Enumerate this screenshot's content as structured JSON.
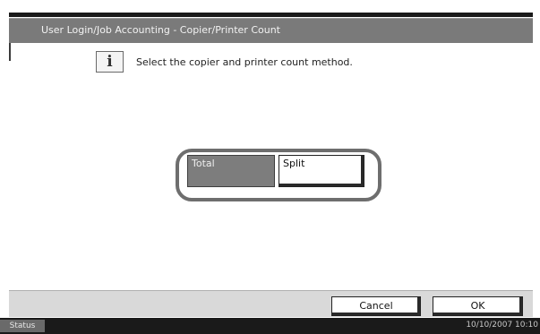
{
  "header": {
    "title": "User Login/Job Accounting - Copier/Printer Count"
  },
  "main": {
    "message": "Select the copier and printer count method.",
    "info_icon": "info-icon",
    "options": {
      "total_label": "Total",
      "split_label": "Split",
      "selected": "Total"
    }
  },
  "footer": {
    "cancel_label": "Cancel",
    "ok_label": "OK"
  },
  "statusbar": {
    "status_label": "Status",
    "datetime": "10/10/2007   10:10"
  },
  "colors": {
    "header": "#7a7a7a",
    "selected_button": "#7d7d7d",
    "statusbar": "#1a1a1a"
  }
}
